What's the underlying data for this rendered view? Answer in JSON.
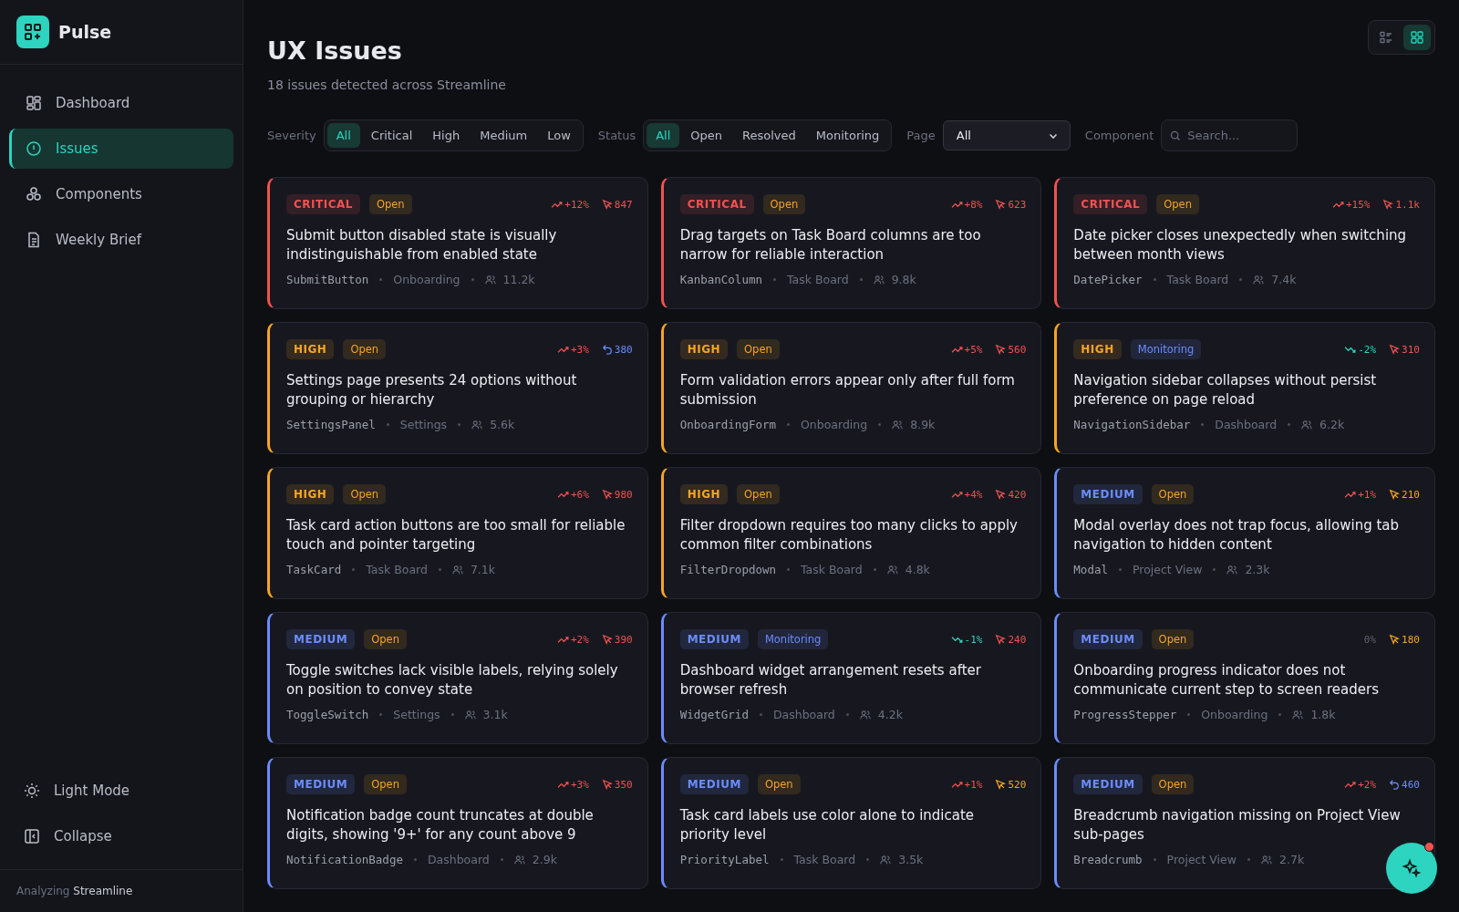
{
  "brand": {
    "name": "Pulse"
  },
  "nav": [
    {
      "label": "Dashboard",
      "selected": false
    },
    {
      "label": "Issues",
      "selected": true
    },
    {
      "label": "Components",
      "selected": false
    },
    {
      "label": "Weekly Brief",
      "selected": false
    }
  ],
  "sidebar_bottom": [
    {
      "label": "Light Mode"
    },
    {
      "label": "Collapse"
    }
  ],
  "footer": "Analyzing **Streamline**",
  "header": {
    "title": "UX Issues",
    "subtitle": "18 issues detected across Streamline"
  },
  "view_toggle": [
    {
      "kind": "list",
      "selected": false
    },
    {
      "kind": "grid",
      "selected": true
    }
  ],
  "filters": {
    "severity": {
      "label": "Severity",
      "options": [
        {
          "label": "All",
          "selected": true
        },
        {
          "label": "Critical",
          "selected": false
        },
        {
          "label": "High",
          "selected": false
        },
        {
          "label": "Medium",
          "selected": false
        },
        {
          "label": "Low",
          "selected": false
        }
      ]
    },
    "status": {
      "label": "Status",
      "options": [
        {
          "label": "All",
          "selected": true
        },
        {
          "label": "Open",
          "selected": false
        },
        {
          "label": "Resolved",
          "selected": false
        },
        {
          "label": "Monitoring",
          "selected": false
        }
      ]
    },
    "page": {
      "label": "Page",
      "value": "All"
    },
    "component": {
      "label": "Component",
      "placeholder": "Search..."
    }
  },
  "issues": [
    {
      "severity": {
        "label": "CRITICAL",
        "color": "#f05252"
      },
      "status": {
        "label": "Open",
        "color": "#f5a524"
      },
      "title": "Submit button disabled state is visually indistinguishable from enabled state",
      "component": "SubmitButton",
      "page": "Onboarding",
      "users": "11.2k",
      "trend": {
        "kind": "up",
        "text": "+12%",
        "color": "#f05252"
      },
      "signal": {
        "kind": "click",
        "count": "847",
        "color": "#f05252"
      }
    },
    {
      "severity": {
        "label": "CRITICAL",
        "color": "#f05252"
      },
      "status": {
        "label": "Open",
        "color": "#f5a524"
      },
      "title": "Drag targets on Task Board columns are too narrow for reliable interaction",
      "component": "KanbanColumn",
      "page": "Task Board",
      "users": "9.8k",
      "trend": {
        "kind": "up",
        "text": "+8%",
        "color": "#f05252"
      },
      "signal": {
        "kind": "click",
        "count": "623",
        "color": "#f05252"
      }
    },
    {
      "severity": {
        "label": "CRITICAL",
        "color": "#f05252"
      },
      "status": {
        "label": "Open",
        "color": "#f5a524"
      },
      "title": "Date picker closes unexpectedly when switching between month views",
      "component": "DatePicker",
      "page": "Task Board",
      "users": "7.4k",
      "trend": {
        "kind": "up",
        "text": "+15%",
        "color": "#f05252"
      },
      "signal": {
        "kind": "click",
        "count": "1.1k",
        "color": "#f05252"
      }
    },
    {
      "severity": {
        "label": "HIGH",
        "color": "#f5a524"
      },
      "status": {
        "label": "Open",
        "color": "#f5a524"
      },
      "title": "Settings page presents 24 options without grouping or hierarchy",
      "component": "SettingsPanel",
      "page": "Settings",
      "users": "5.6k",
      "trend": {
        "kind": "up",
        "text": "+3%",
        "color": "#f05252"
      },
      "signal": {
        "kind": "undo",
        "count": "380",
        "color": "#6b8cff"
      }
    },
    {
      "severity": {
        "label": "HIGH",
        "color": "#f5a524"
      },
      "status": {
        "label": "Open",
        "color": "#f5a524"
      },
      "title": "Form validation errors appear only after full form submission",
      "component": "OnboardingForm",
      "page": "Onboarding",
      "users": "8.9k",
      "trend": {
        "kind": "up",
        "text": "+5%",
        "color": "#f05252"
      },
      "signal": {
        "kind": "click",
        "count": "560",
        "color": "#f05252"
      }
    },
    {
      "severity": {
        "label": "HIGH",
        "color": "#f5a524"
      },
      "status": {
        "label": "Monitoring",
        "color": "#6b8cff"
      },
      "title": "Navigation sidebar collapses without persist preference on page reload",
      "component": "NavigationSidebar",
      "page": "Dashboard",
      "users": "6.2k",
      "trend": {
        "kind": "down",
        "text": "-2%",
        "color": "#2dd4bf"
      },
      "signal": {
        "kind": "click",
        "count": "310",
        "color": "#f05252"
      }
    },
    {
      "severity": {
        "label": "HIGH",
        "color": "#f5a524"
      },
      "status": {
        "label": "Open",
        "color": "#f5a524"
      },
      "title": "Task card action buttons are too small for reliable touch and pointer targeting",
      "component": "TaskCard",
      "page": "Task Board",
      "users": "7.1k",
      "trend": {
        "kind": "up",
        "text": "+6%",
        "color": "#f05252"
      },
      "signal": {
        "kind": "click",
        "count": "980",
        "color": "#f05252"
      }
    },
    {
      "severity": {
        "label": "HIGH",
        "color": "#f5a524"
      },
      "status": {
        "label": "Open",
        "color": "#f5a524"
      },
      "title": "Filter dropdown requires too many clicks to apply common filter combinations",
      "component": "FilterDropdown",
      "page": "Task Board",
      "users": "4.8k",
      "trend": {
        "kind": "up",
        "text": "+4%",
        "color": "#f05252"
      },
      "signal": {
        "kind": "click",
        "count": "420",
        "color": "#f05252"
      }
    },
    {
      "severity": {
        "label": "MEDIUM",
        "color": "#6b8cff"
      },
      "status": {
        "label": "Open",
        "color": "#f5a524"
      },
      "title": "Modal overlay does not trap focus, allowing tab navigation to hidden content",
      "component": "Modal",
      "page": "Project View",
      "users": "2.3k",
      "trend": {
        "kind": "up",
        "text": "+1%",
        "color": "#f05252"
      },
      "signal": {
        "kind": "click",
        "count": "210",
        "color": "#f5a524"
      }
    },
    {
      "severity": {
        "label": "MEDIUM",
        "color": "#6b8cff"
      },
      "status": {
        "label": "Open",
        "color": "#f5a524"
      },
      "title": "Toggle switches lack visible labels, relying solely on position to convey state",
      "component": "ToggleSwitch",
      "page": "Settings",
      "users": "3.1k",
      "trend": {
        "kind": "up",
        "text": "+2%",
        "color": "#f05252"
      },
      "signal": {
        "kind": "click",
        "count": "390",
        "color": "#f05252"
      }
    },
    {
      "severity": {
        "label": "MEDIUM",
        "color": "#6b8cff"
      },
      "status": {
        "label": "Monitoring",
        "color": "#6b8cff"
      },
      "title": "Dashboard widget arrangement resets after browser refresh",
      "component": "WidgetGrid",
      "page": "Dashboard",
      "users": "4.2k",
      "trend": {
        "kind": "down",
        "text": "-1%",
        "color": "#2dd4bf"
      },
      "signal": {
        "kind": "click",
        "count": "240",
        "color": "#f05252"
      }
    },
    {
      "severity": {
        "label": "MEDIUM",
        "color": "#6b8cff"
      },
      "status": {
        "label": "Open",
        "color": "#f5a524"
      },
      "title": "Onboarding progress indicator does not communicate current step to screen readers",
      "component": "ProgressStepper",
      "page": "Onboarding",
      "users": "1.8k",
      "trend": {
        "kind": "flat",
        "text": "0%",
        "color": "#5d6270"
      },
      "signal": {
        "kind": "click",
        "count": "180",
        "color": "#f5a524"
      }
    },
    {
      "severity": {
        "label": "MEDIUM",
        "color": "#6b8cff"
      },
      "status": {
        "label": "Open",
        "color": "#f5a524"
      },
      "title": "Notification badge count truncates at double digits, showing '9+' for any count above 9",
      "component": "NotificationBadge",
      "page": "Dashboard",
      "users": "2.9k",
      "trend": {
        "kind": "up",
        "text": "+3%",
        "color": "#f05252"
      },
      "signal": {
        "kind": "click",
        "count": "350",
        "color": "#f05252"
      }
    },
    {
      "severity": {
        "label": "MEDIUM",
        "color": "#6b8cff"
      },
      "status": {
        "label": "Open",
        "color": "#f5a524"
      },
      "title": "Task card labels use color alone to indicate priority level",
      "component": "PriorityLabel",
      "page": "Task Board",
      "users": "3.5k",
      "trend": {
        "kind": "up",
        "text": "+1%",
        "color": "#f05252"
      },
      "signal": {
        "kind": "click",
        "count": "520",
        "color": "#f5a524"
      }
    },
    {
      "severity": {
        "label": "MEDIUM",
        "color": "#6b8cff"
      },
      "status": {
        "label": "Open",
        "color": "#f5a524"
      },
      "title": "Breadcrumb navigation missing on Project View sub-pages",
      "component": "Breadcrumb",
      "page": "Project View",
      "users": "2.7k",
      "trend": {
        "kind": "up",
        "text": "+2%",
        "color": "#f05252"
      },
      "signal": {
        "kind": "undo",
        "count": "460",
        "color": "#6b8cff"
      }
    }
  ],
  "assistant": {
    "notification": true
  }
}
